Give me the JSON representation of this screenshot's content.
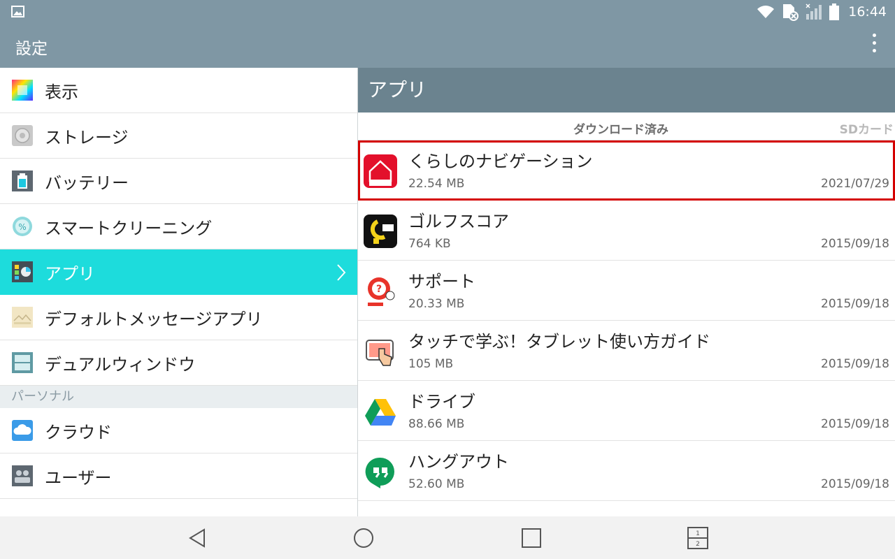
{
  "status": {
    "time": "16:44"
  },
  "app_bar": {
    "title": "設定"
  },
  "left_menu": {
    "items": [
      {
        "label": "表示"
      },
      {
        "label": "ストレージ"
      },
      {
        "label": "バッテリー"
      },
      {
        "label": "スマートクリーニング"
      },
      {
        "label": "アプリ",
        "active": true
      },
      {
        "label": "デフォルトメッセージアプリ"
      },
      {
        "label": "デュアルウィンドウ"
      }
    ],
    "section_personal": "パーソナル",
    "personal_items": [
      {
        "label": "クラウド"
      },
      {
        "label": "ユーザー"
      }
    ]
  },
  "right_panel": {
    "title": "アプリ",
    "tabs": {
      "downloaded": "ダウンロード済み",
      "sd_card": "SDカード"
    },
    "apps": [
      {
        "name": "くらしのナビゲーション",
        "size": "22.54 MB",
        "date": "2021/07/29"
      },
      {
        "name": "ゴルフスコア",
        "size": "764 KB",
        "date": "2015/09/18"
      },
      {
        "name": "サポート",
        "size": "20.33 MB",
        "date": "2015/09/18"
      },
      {
        "name": "タッチで学ぶ！タブレット使い方ガイド",
        "size": "105 MB",
        "date": "2015/09/18"
      },
      {
        "name": "ドライブ",
        "size": "88.66 MB",
        "date": "2015/09/18"
      },
      {
        "name": "ハングアウト",
        "size": "52.60 MB",
        "date": "2015/09/18"
      }
    ]
  },
  "colors": {
    "header": "#7f97a4",
    "panel_header": "#6b838f",
    "accent": "#1ddcdc",
    "highlight": "#d40000"
  }
}
